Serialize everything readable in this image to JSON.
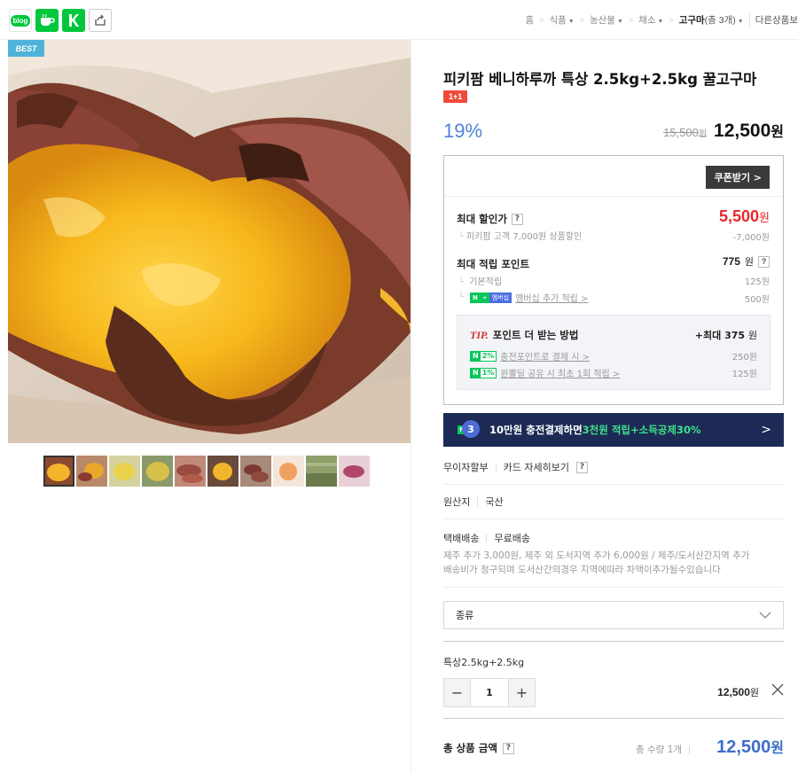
{
  "topbar": {
    "share_icons": [
      {
        "name": "blog-share-icon",
        "text": "blog"
      },
      {
        "name": "cafe-share-icon"
      },
      {
        "name": "kakao-share-icon"
      },
      {
        "name": "share-icon"
      }
    ],
    "breadcrumb": {
      "home": "홈",
      "items": [
        "식품",
        "농산물",
        "채소"
      ],
      "current": "고구마",
      "current_count": "(총 3개)",
      "other": "다른상품보"
    }
  },
  "gallery": {
    "badge": "BEST",
    "thumb_count": 10
  },
  "product": {
    "title": "피키팜 베니하루까 특상 2.5kg+2.5kg 꿀고구마",
    "promo_badge": "1+1",
    "discount_rate": "19%",
    "original_price": "15,500",
    "original_unit": "원",
    "sale_price": "12,500",
    "sale_unit": "원"
  },
  "benefit": {
    "coupon_button": "쿠폰받기 >",
    "max_discount_label": "최대 할인가",
    "max_discount_value": "5,500",
    "max_discount_unit": "원",
    "max_discount_sub": "피키팜 고객 7,000원 상품할인",
    "max_discount_sub_value": "-7,000원",
    "max_point_label": "최대 적립 포인트",
    "max_point_value": "775",
    "max_point_unit": "원",
    "base_point_label": "기본적립",
    "base_point_value": "125원",
    "membership_badge_n": "N",
    "membership_badge_plus": "+",
    "membership_badge_text": "멤버십",
    "membership_label": "멤버십 추가 적립 >",
    "membership_value": "500원",
    "tip": {
      "tip_word": "TIP.",
      "title": "포인트 더 받는 방법",
      "max": "+최대 375",
      "max_unit": "원",
      "rows": [
        {
          "pct": "2%",
          "label": "충전포인트로 결제 시 >",
          "value": "250원"
        },
        {
          "pct": "1%",
          "label": "원뿔딜 공유 시 최초 1회 적립 >",
          "value": "125원"
        }
      ]
    }
  },
  "banner": {
    "badge_n": "N",
    "badge_num": "3",
    "text1": "10만원 충전결제하면 ",
    "highlight": "3천원 적립+소득공제30%",
    "arrow": ">"
  },
  "info": {
    "installment": "무이자할부",
    "card_detail": "카드 자세히보기",
    "origin_label": "원산지",
    "origin_value": "국산",
    "delivery_label": "택배배송",
    "delivery_value": "무료배송",
    "ship_note_1": "제주 추가 3,000원, 제주 외 도서지역 추가 6,000원 / 제주/도서산간지역 추가",
    "ship_note_2": "배송비가 청구되며 도서산간의경우 지역에따라 차액이추가될수있습니다"
  },
  "option": {
    "select_label": "종류",
    "selected_name": "특상2.5kg+2.5kg",
    "quantity": "1",
    "price": "12,500",
    "price_unit": "원"
  },
  "total": {
    "label": "총 상품 금액",
    "qty_text": "총 수량 1개",
    "amount": "12,500",
    "amount_unit": "원"
  },
  "colors": {
    "discount_blue": "#4c84d6",
    "max_discount_red": "#e8272b",
    "naver_green": "#03c75a",
    "banner_navy": "#1c2a55",
    "total_blue": "#3d6ec9"
  }
}
